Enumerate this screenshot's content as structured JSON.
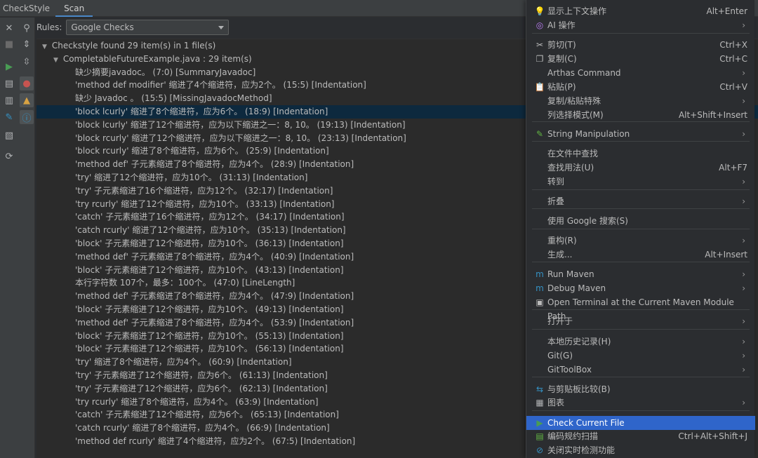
{
  "tabs": [
    "CheckStyle",
    "Scan"
  ],
  "rules": {
    "label": "Rules:",
    "selected": "Google Checks"
  },
  "tree": {
    "root": "Checkstyle found 29 item(s) in 1 file(s)",
    "file": "CompletableFutureExample.java : 29 item(s)",
    "items": [
      "缺少摘要javadoc。 (7:0) [SummaryJavadoc]",
      "'method def modifier' 缩进了4个缩进符，应为2个。 (15:5) [Indentation]",
      "缺少 Javadoc 。 (15:5) [MissingJavadocMethod]",
      "'block lcurly' 缩进了8个缩进符，应为6个。 (18:9) [Indentation]",
      "'block lcurly' 缩进了12个缩进符，应为以下缩进之一：8, 10。 (19:13) [Indentation]",
      "'block rcurly' 缩进了12个缩进符，应为以下缩进之一：8, 10。 (23:13) [Indentation]",
      "'block rcurly' 缩进了8个缩进符，应为6个。 (25:9) [Indentation]",
      "'method def' 子元素缩进了8个缩进符，应为4个。 (28:9) [Indentation]",
      "'try' 缩进了12个缩进符，应为10个。 (31:13) [Indentation]",
      "'try' 子元素缩进了16个缩进符，应为12个。 (32:17) [Indentation]",
      "'try rcurly' 缩进了12个缩进符，应为10个。 (33:13) [Indentation]",
      "'catch' 子元素缩进了16个缩进符，应为12个。 (34:17) [Indentation]",
      "'catch rcurly' 缩进了12个缩进符，应为10个。 (35:13) [Indentation]",
      "'block' 子元素缩进了12个缩进符，应为10个。 (36:13) [Indentation]",
      "'method def' 子元素缩进了8个缩进符，应为4个。 (40:9) [Indentation]",
      "'block' 子元素缩进了12个缩进符，应为10个。 (43:13) [Indentation]",
      "本行字符数 107个，最多：100个。 (47:0) [LineLength]",
      "'method def' 子元素缩进了8个缩进符，应为4个。 (47:9) [Indentation]",
      "'block' 子元素缩进了12个缩进符，应为10个。 (49:13) [Indentation]",
      "'method def' 子元素缩进了8个缩进符，应为4个。 (53:9) [Indentation]",
      "'block' 子元素缩进了12个缩进符，应为10个。 (55:13) [Indentation]",
      "'block' 子元素缩进了12个缩进符，应为10个。 (56:13) [Indentation]",
      "'try' 缩进了8个缩进符，应为4个。 (60:9) [Indentation]",
      "'try' 子元素缩进了12个缩进符，应为6个。 (61:13) [Indentation]",
      "'try' 子元素缩进了12个缩进符，应为6个。 (62:13) [Indentation]",
      "'try rcurly' 缩进了8个缩进符，应为4个。 (63:9) [Indentation]",
      "'catch' 子元素缩进了12个缩进符，应为6个。 (65:13) [Indentation]",
      "'catch rcurly' 缩进了8个缩进符，应为4个。 (66:9) [Indentation]",
      "'method def rcurly' 缩进了4个缩进符，应为2个。 (67:5) [Indentation]"
    ]
  },
  "menu": {
    "items": [
      {
        "label": "显示上下文操作",
        "shortcut": "Alt+Enter",
        "icon": "bulb-icon",
        "glyph": "💡"
      },
      {
        "label": "AI 操作",
        "sub": true,
        "icon": "ai-icon",
        "glyph": "◎"
      },
      {
        "label": "剪切(T)",
        "shortcut": "Ctrl+X",
        "icon": "scissors-icon",
        "glyph": "✂"
      },
      {
        "label": "复制(C)",
        "shortcut": "Ctrl+C",
        "icon": "copy-icon",
        "glyph": "❐"
      },
      {
        "label": "Arthas Command",
        "sub": true
      },
      {
        "label": "粘贴(P)",
        "shortcut": "Ctrl+V",
        "icon": "paste-icon",
        "glyph": "📋"
      },
      {
        "label": "复制/粘贴特殊",
        "sub": true
      },
      {
        "label": "列选择模式(M)",
        "shortcut": "Alt+Shift+Insert"
      },
      {
        "label": "String Manipulation",
        "sub": true,
        "icon": "pencil-icon",
        "glyph": "✎"
      },
      {
        "label": "在文件中查找"
      },
      {
        "label": "查找用法(U)",
        "shortcut": "Alt+F7"
      },
      {
        "label": "转到",
        "sub": true
      },
      {
        "label": "折叠",
        "sub": true
      },
      {
        "label": "使用 Google 搜索(S)"
      },
      {
        "label": "重构(R)",
        "sub": true
      },
      {
        "label": "生成...",
        "shortcut": "Alt+Insert"
      },
      {
        "label": "Run Maven",
        "sub": true,
        "icon": "maven-run-icon",
        "glyph": "m"
      },
      {
        "label": "Debug Maven",
        "sub": true,
        "icon": "maven-debug-icon",
        "glyph": "m"
      },
      {
        "label": "Open Terminal at the Current Maven Module Path",
        "icon": "terminal-icon",
        "glyph": "▣"
      },
      {
        "label": "打开于",
        "sub": true
      },
      {
        "label": "本地历史记录(H)",
        "sub": true
      },
      {
        "label": "Git(G)",
        "sub": true
      },
      {
        "label": "GitToolBox",
        "sub": true
      },
      {
        "label": "与剪贴板比较(B)",
        "icon": "compare-icon",
        "glyph": "⇆"
      },
      {
        "label": "图表",
        "sub": true,
        "icon": "diagram-icon",
        "glyph": "▦"
      },
      {
        "label": "Check Current File",
        "icon": "run-check-icon",
        "glyph": "▶",
        "highlight": true
      },
      {
        "label": "编码规约扫描",
        "shortcut": "Ctrl+Alt+Shift+J",
        "icon": "scan-icon",
        "glyph": "▤"
      },
      {
        "label": "关闭实时检测功能",
        "icon": "disable-icon",
        "glyph": "⊘"
      }
    ]
  },
  "colors": {
    "selection": "#0d293e",
    "menu_highlight": "#2f65ca",
    "error": "#c75450",
    "warning": "#d9a343",
    "info": "#3592c4",
    "run": "#499c54"
  }
}
